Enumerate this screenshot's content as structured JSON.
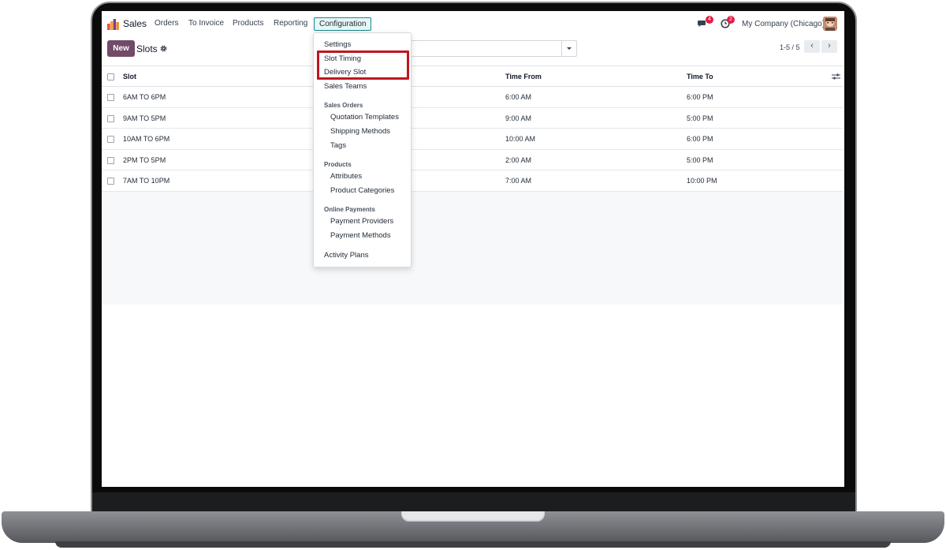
{
  "navbar": {
    "app_name": "Sales",
    "menu": [
      "Orders",
      "To Invoice",
      "Products",
      "Reporting"
    ],
    "active_menu": "Configuration",
    "messages_count": "4",
    "activities_count": "2",
    "company": "My Company (Chicago)"
  },
  "control_panel": {
    "new_label": "New",
    "title": "Slots",
    "pager": "1-5 / 5"
  },
  "table": {
    "headers": {
      "slot": "Slot",
      "time_from": "Time From",
      "time_to": "Time To"
    },
    "rows": [
      {
        "slot": "6AM TO 6PM",
        "time_from": "6:00 AM",
        "time_to": "6:00 PM"
      },
      {
        "slot": "9AM TO 5PM",
        "time_from": "9:00 AM",
        "time_to": "5:00 PM"
      },
      {
        "slot": "10AM TO 6PM",
        "time_from": "10:00 AM",
        "time_to": "6:00 PM"
      },
      {
        "slot": "2PM TO 5PM",
        "time_from": "2:00 AM",
        "time_to": "5:00 PM"
      },
      {
        "slot": "7AM TO 10PM",
        "time_from": "7:00 AM",
        "time_to": "10:00 PM"
      }
    ]
  },
  "config_menu": {
    "settings": "Settings",
    "slot_timing": "Slot Timing",
    "delivery_slot": "Delivery Slot",
    "sales_teams": "Sales Teams",
    "sales_orders_header": "Sales Orders",
    "quotation_templates": "Quotation Templates",
    "shipping_methods": "Shipping Methods",
    "tags": "Tags",
    "products_header": "Products",
    "attributes": "Attributes",
    "product_categories": "Product Categories",
    "online_payments_header": "Online Payments",
    "payment_providers": "Payment Providers",
    "payment_methods": "Payment Methods",
    "activity_plans": "Activity Plans"
  },
  "colors": {
    "primary": "#714b67",
    "highlight": "#c0161d",
    "active_border": "#0f8a8e",
    "badge": "#e11d48"
  },
  "icons": [
    "app-logo-icon",
    "chat-icon",
    "clock-icon",
    "gear-icon",
    "caret-down-icon",
    "chevron-left-icon",
    "chevron-right-icon",
    "column-options-icon"
  ]
}
